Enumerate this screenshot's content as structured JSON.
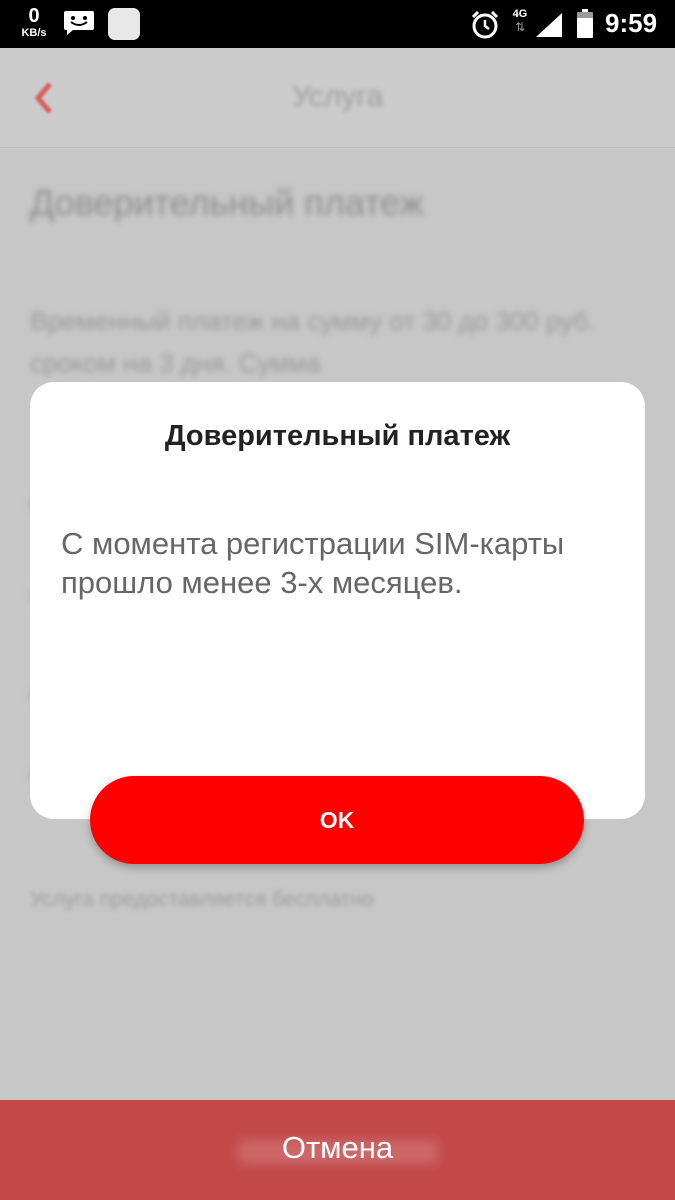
{
  "status_bar": {
    "speed_value": "0",
    "speed_unit": "KB/s",
    "network_type": "4G",
    "network_arrows": "⇅",
    "time": "9:59",
    "icons": [
      "message-icon",
      "app-icon",
      "alarm-icon",
      "signal-icon",
      "battery-icon"
    ]
  },
  "dialog": {
    "title": "Доверительный платеж",
    "message": "С момента регистрации SIM-карты прошло менее 3-х месяцев.",
    "ok_label": "OK"
  },
  "bottom_bar": {
    "cancel_label": "Отмена"
  },
  "colors": {
    "accent": "#ff0000",
    "cancel_bar": "#c34848",
    "dim_background": "#c4c4c4"
  }
}
